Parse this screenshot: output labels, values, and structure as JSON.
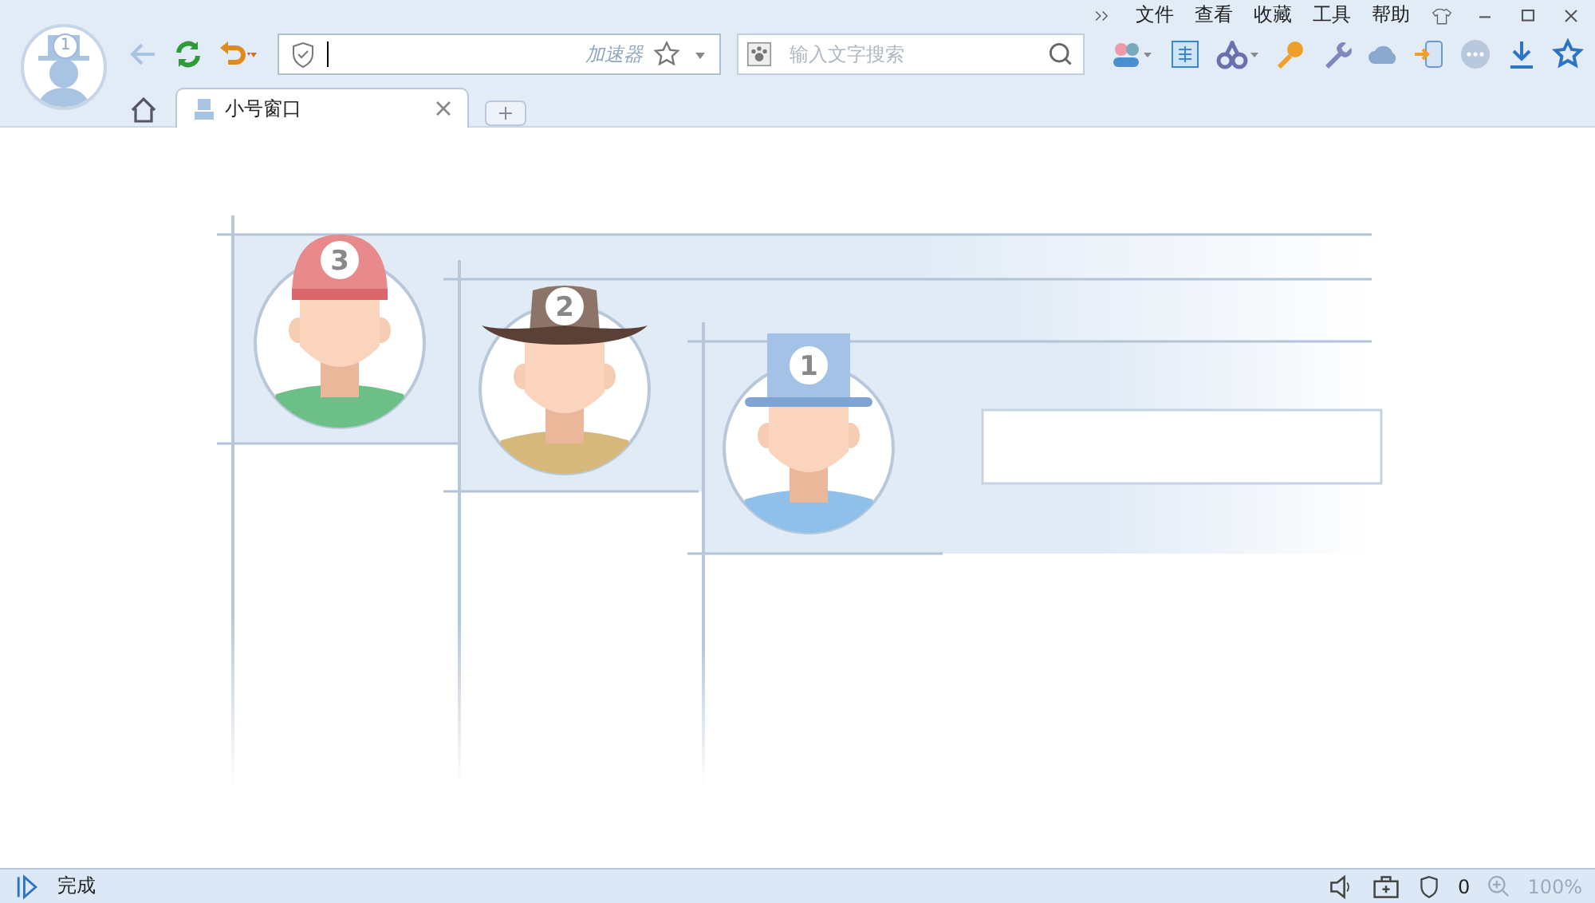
{
  "profile": {
    "badge": "1"
  },
  "menu": [
    "文件",
    "查看",
    "收藏",
    "工具",
    "帮助"
  ],
  "address_bar": {
    "accelerator_label": "加速器"
  },
  "search": {
    "placeholder": "输入文字搜索"
  },
  "tabs": [
    {
      "label": "小号窗口",
      "selected": true
    }
  ],
  "illustration": {
    "avatars": [
      {
        "number": "3",
        "kind": "cap",
        "color": "#e88a8c"
      },
      {
        "number": "2",
        "kind": "cowboy",
        "color": "#8c7468"
      },
      {
        "number": "1",
        "kind": "top",
        "color": "#a4c2e6"
      }
    ]
  },
  "status_bar": {
    "text": "完成",
    "ad_count": "0",
    "zoom": "100%"
  }
}
